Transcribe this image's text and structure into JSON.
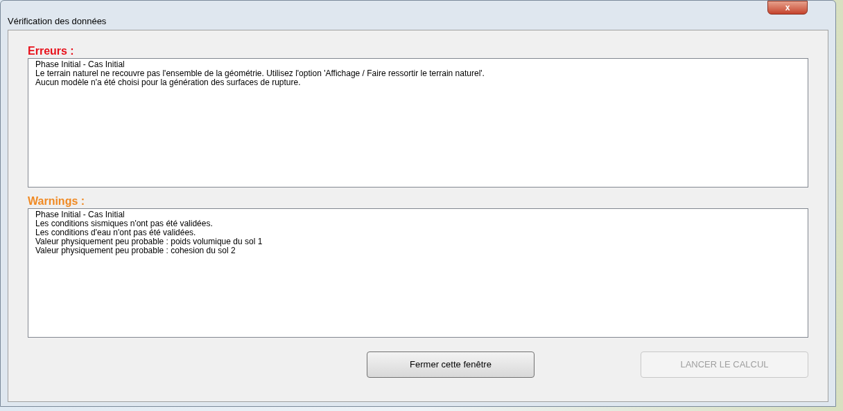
{
  "window": {
    "title": "Vérification des données",
    "close_label": "x"
  },
  "sections": [
    {
      "kind": "error",
      "heading": "Erreurs :",
      "lines": [
        "Phase Initial - Cas Initial",
        "Le terrain naturel ne recouvre pas l'ensemble de la géométrie. Utilisez l'option 'Affichage / Faire ressortir le terrain naturel'.",
        "Aucun modèle n'a été choisi pour la génération des surfaces de rupture."
      ]
    },
    {
      "kind": "warning",
      "heading": "Warnings :",
      "lines": [
        "Phase Initial - Cas Initial",
        "Les conditions sismiques n'ont pas été validées.",
        "Les conditions d'eau n'ont pas été validées.",
        "Valeur physiquement peu probable : poids volumique du sol 1",
        "Valeur physiquement peu probable : cohesion du sol 2"
      ]
    }
  ],
  "buttons": [
    {
      "label": "Fermer cette fenêtre",
      "disabled": false
    },
    {
      "label": "LANCER LE CALCUL",
      "disabled": true
    }
  ]
}
